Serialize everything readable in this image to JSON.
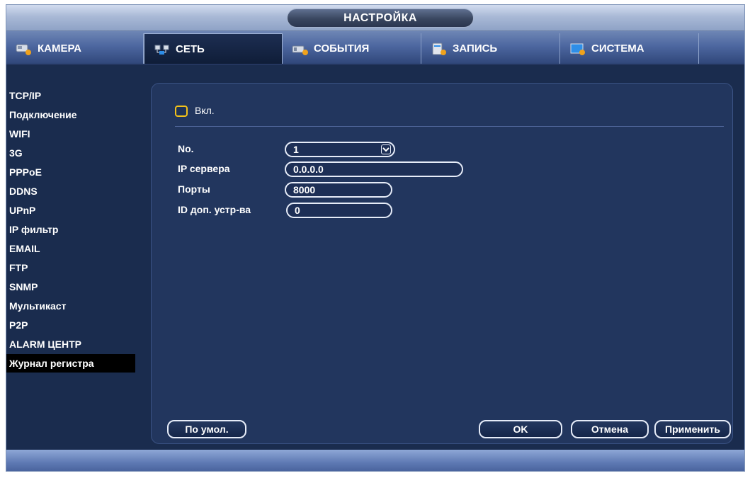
{
  "window": {
    "title": "НАСТРОЙКА"
  },
  "tabs": [
    {
      "label": "КАМЕРА",
      "icon": "camera-icon"
    },
    {
      "label": "СЕТЬ",
      "icon": "network-icon",
      "active": true
    },
    {
      "label": "СОБЫТИЯ",
      "icon": "events-icon"
    },
    {
      "label": "ЗАПИСЬ",
      "icon": "record-icon"
    },
    {
      "label": "СИСТЕМА",
      "icon": "system-icon"
    }
  ],
  "sidebar": {
    "items": [
      {
        "label": "TCP/IP"
      },
      {
        "label": "Подключение"
      },
      {
        "label": "WIFI"
      },
      {
        "label": "3G"
      },
      {
        "label": "PPPoE"
      },
      {
        "label": "DDNS"
      },
      {
        "label": "UPnP"
      },
      {
        "label": "IP фильтр"
      },
      {
        "label": "EMAIL"
      },
      {
        "label": "FTP"
      },
      {
        "label": "SNMP"
      },
      {
        "label": "Мультикаст"
      },
      {
        "label": "P2P"
      },
      {
        "label": "ALARM ЦЕНТР"
      },
      {
        "label": "Журнал регистра",
        "active": true
      }
    ]
  },
  "form": {
    "enable_label": "Вкл.",
    "no_label": "No.",
    "no_value": "1",
    "server_ip_label": "IP сервера",
    "server_ip_value": "0.0.0.0",
    "port_label": "Порты",
    "port_value": "8000",
    "device_id_label": "ID доп. устр-ва",
    "device_id_value": "0"
  },
  "buttons": {
    "default": "По умол.",
    "ok": "OK",
    "cancel": "Отмена",
    "apply": "Применить"
  },
  "colors": {
    "accent_checkbox": "#f3c21a",
    "panel_bg": "#22365e",
    "window_bg": "#1a2c4e"
  }
}
